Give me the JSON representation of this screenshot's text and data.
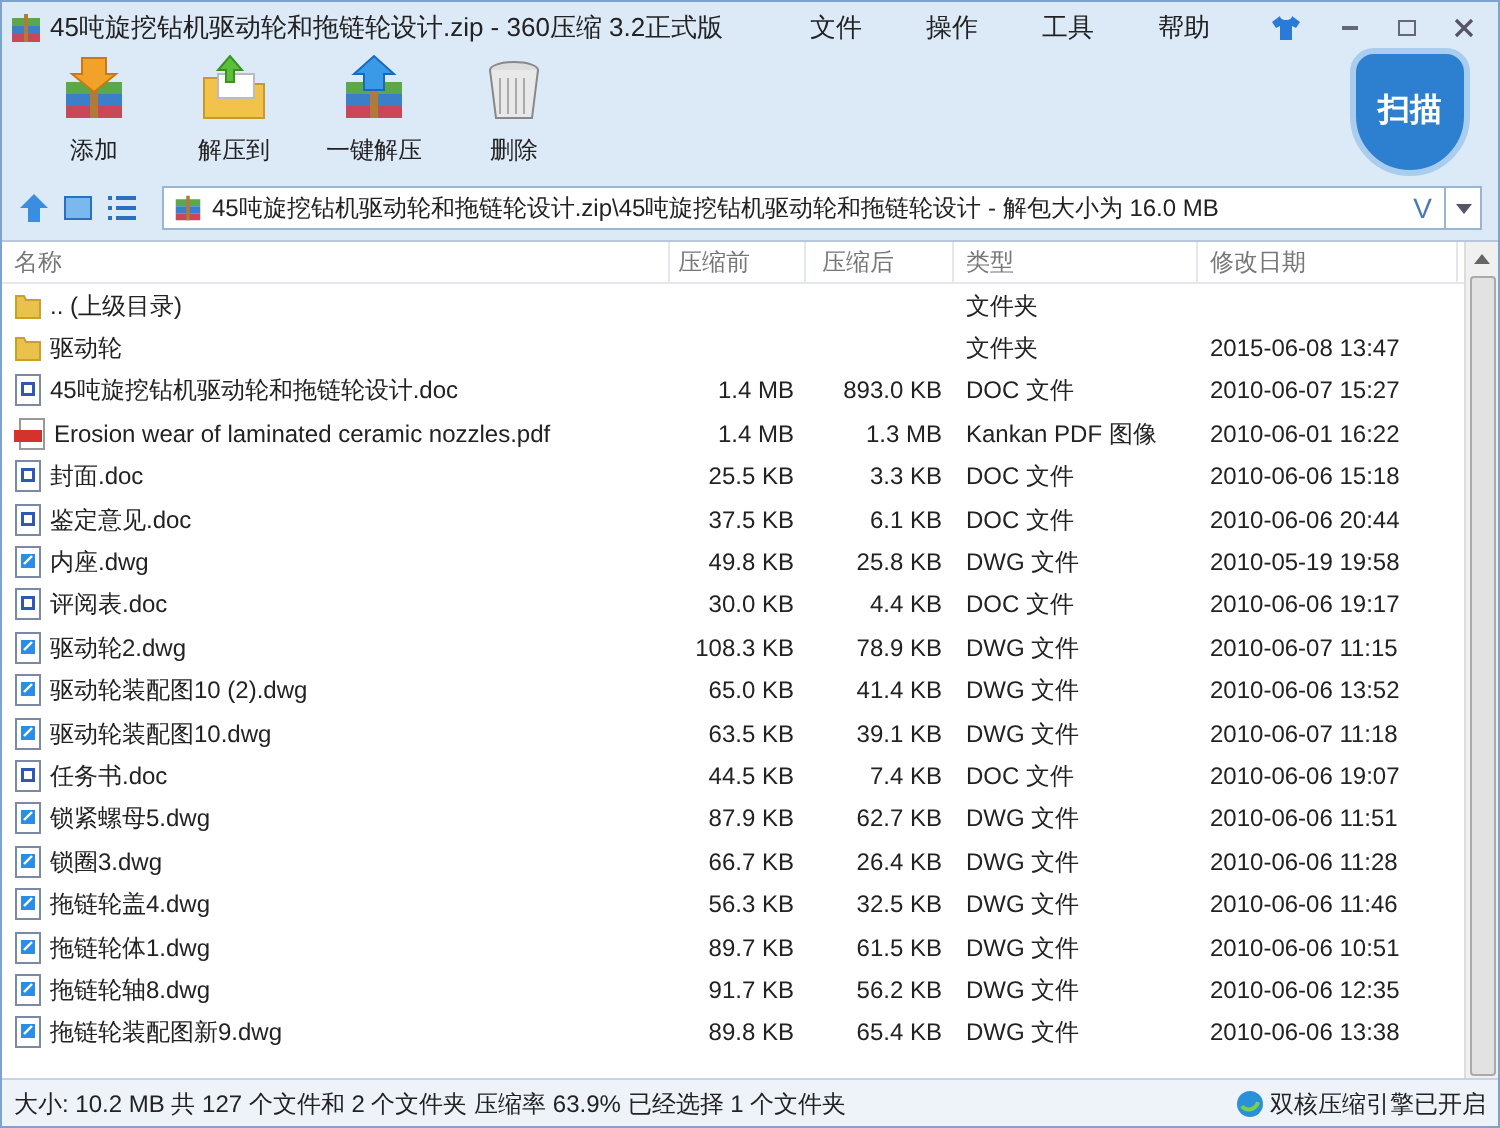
{
  "window": {
    "title": "45吨旋挖钻机驱动轮和拖链轮设计.zip - 360压缩 3.2正式版"
  },
  "menu": [
    "文件",
    "操作",
    "工具",
    "帮助"
  ],
  "toolbar": [
    {
      "label": "添加",
      "kind": "add"
    },
    {
      "label": "解压到",
      "kind": "extract"
    },
    {
      "label": "一键解压",
      "kind": "oneclick"
    },
    {
      "label": "删除",
      "kind": "delete"
    }
  ],
  "scan_button": {
    "label": "扫描"
  },
  "address": {
    "value": "45吨旋挖钻机驱动轮和拖链轮设计.zip\\45吨旋挖钻机驱动轮和拖链轮设计 - 解包大小为 16.0 MB",
    "dropdown_glyph": "V"
  },
  "table": {
    "columns": [
      "名称",
      "压缩前",
      "压缩后",
      "类型",
      "修改日期"
    ],
    "rows": [
      {
        "kind": "folder",
        "name": ".. (上级目录)",
        "size": "",
        "packed": "",
        "type": "文件夹",
        "date": ""
      },
      {
        "kind": "folder",
        "name": "驱动轮",
        "size": "",
        "packed": "",
        "type": "文件夹",
        "date": "2015-06-08 13:47"
      },
      {
        "kind": "doc",
        "name": "45吨旋挖钻机驱动轮和拖链轮设计.doc",
        "size": "1.4 MB",
        "packed": "893.0 KB",
        "type": "DOC 文件",
        "date": "2010-06-07 15:27"
      },
      {
        "kind": "pdf",
        "name": "Erosion wear of laminated ceramic nozzles.pdf",
        "size": "1.4 MB",
        "packed": "1.3 MB",
        "type": "Kankan PDF 图像",
        "date": "2010-06-01 16:22"
      },
      {
        "kind": "doc",
        "name": "封面.doc",
        "size": "25.5 KB",
        "packed": "3.3 KB",
        "type": "DOC 文件",
        "date": "2010-06-06 15:18"
      },
      {
        "kind": "doc",
        "name": "鉴定意见.doc",
        "size": "37.5 KB",
        "packed": "6.1 KB",
        "type": "DOC 文件",
        "date": "2010-06-06 20:44"
      },
      {
        "kind": "dwg",
        "name": "内座.dwg",
        "size": "49.8 KB",
        "packed": "25.8 KB",
        "type": "DWG 文件",
        "date": "2010-05-19 19:58"
      },
      {
        "kind": "doc",
        "name": "评阅表.doc",
        "size": "30.0 KB",
        "packed": "4.4 KB",
        "type": "DOC 文件",
        "date": "2010-06-06 19:17"
      },
      {
        "kind": "dwg",
        "name": "驱动轮2.dwg",
        "size": "108.3 KB",
        "packed": "78.9 KB",
        "type": "DWG 文件",
        "date": "2010-06-07 11:15"
      },
      {
        "kind": "dwg",
        "name": "驱动轮装配图10 (2).dwg",
        "size": "65.0 KB",
        "packed": "41.4 KB",
        "type": "DWG 文件",
        "date": "2010-06-06 13:52"
      },
      {
        "kind": "dwg",
        "name": "驱动轮装配图10.dwg",
        "size": "63.5 KB",
        "packed": "39.1 KB",
        "type": "DWG 文件",
        "date": "2010-06-07 11:18"
      },
      {
        "kind": "doc",
        "name": "任务书.doc",
        "size": "44.5 KB",
        "packed": "7.4 KB",
        "type": "DOC 文件",
        "date": "2010-06-06 19:07"
      },
      {
        "kind": "dwg",
        "name": "锁紧螺母5.dwg",
        "size": "87.9 KB",
        "packed": "62.7 KB",
        "type": "DWG 文件",
        "date": "2010-06-06 11:51"
      },
      {
        "kind": "dwg",
        "name": "锁圈3.dwg",
        "size": "66.7 KB",
        "packed": "26.4 KB",
        "type": "DWG 文件",
        "date": "2010-06-06 11:28"
      },
      {
        "kind": "dwg",
        "name": "拖链轮盖4.dwg",
        "size": "56.3 KB",
        "packed": "32.5 KB",
        "type": "DWG 文件",
        "date": "2010-06-06 11:46"
      },
      {
        "kind": "dwg",
        "name": "拖链轮体1.dwg",
        "size": "89.7 KB",
        "packed": "61.5 KB",
        "type": "DWG 文件",
        "date": "2010-06-06 10:51"
      },
      {
        "kind": "dwg",
        "name": "拖链轮轴8.dwg",
        "size": "91.7 KB",
        "packed": "56.2 KB",
        "type": "DWG 文件",
        "date": "2010-06-06 12:35"
      },
      {
        "kind": "dwg",
        "name": "拖链轮装配图新9.dwg",
        "size": "89.8 KB",
        "packed": "65.4 KB",
        "type": "DWG 文件",
        "date": "2010-06-06 13:38"
      }
    ]
  },
  "status_bar": {
    "summary": "大小: 10.2 MB 共 127 个文件和 2 个文件夹 压缩率 63.9% 已经选择 1 个文件夹",
    "engine": "双核压缩引擎已开启"
  }
}
